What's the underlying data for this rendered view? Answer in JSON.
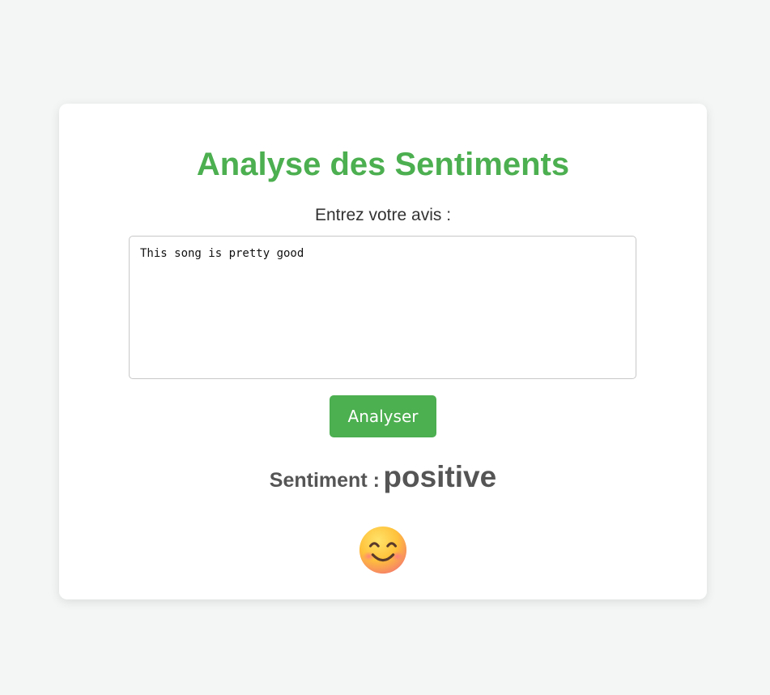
{
  "page": {
    "title": "Analyse des Sentiments",
    "input_label": "Entrez votre avis :",
    "review_text": "This song is pretty good",
    "submit_label": "Analyser",
    "result_label": "Sentiment :",
    "result_value": "positive",
    "result_icon": "smiling-face-emoji"
  },
  "colors": {
    "accent": "#4caf50",
    "background": "#f4f6f6",
    "card": "#ffffff",
    "result_text": "#555555"
  }
}
